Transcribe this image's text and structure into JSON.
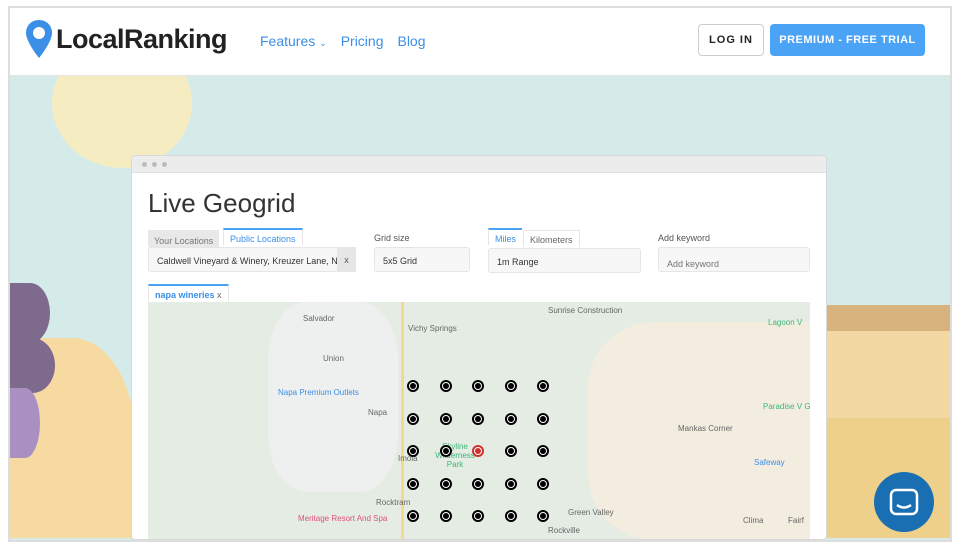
{
  "header": {
    "logo": "LocalRanking",
    "nav": [
      {
        "label": "Features",
        "has_dropdown": true
      },
      {
        "label": "Pricing"
      },
      {
        "label": "Blog"
      }
    ],
    "login": "LOG IN",
    "trial": "PREMIUM - FREE TRIAL"
  },
  "colors": {
    "accent": "#4aa3f5",
    "link": "#3b8fe6",
    "background": "#d4ebe9",
    "chat": "#1a6fb3",
    "center_pin": "#d0312d"
  },
  "card": {
    "title": "Live Geogrid",
    "location_tabs": [
      "Your Locations",
      "Public Locations"
    ],
    "active_location_tab": "Public Locations",
    "location_value": "Caldwell Vineyard & Winery, Kreuzer Lane, Na",
    "location_clear": "x",
    "grid_label": "Grid size",
    "grid_value": "5x5 Grid",
    "unit_tabs": [
      "Miles",
      "Kilometers"
    ],
    "active_unit_tab": "Miles",
    "range_value": "1m Range",
    "keyword_label": "Add keyword",
    "keyword_placeholder": "Add keyword",
    "keyword_tab": "napa wineries",
    "keyword_close": "x"
  },
  "map": {
    "labels": [
      "Salvador",
      "Vichy Springs",
      "Sunrise Construction",
      "Lagoon V",
      "Union",
      "Napa Premium Outlets",
      "Napa",
      "Imola",
      "Skyline Wilderness Park",
      "Mankas Corner",
      "Safeway",
      "Paradise V Golf Co",
      "Rocktram",
      "Meritage Resort And Spa",
      "Green Valley",
      "Clima",
      "Fairf",
      "Rockville"
    ],
    "grid_size": 5,
    "center_index": 12
  }
}
